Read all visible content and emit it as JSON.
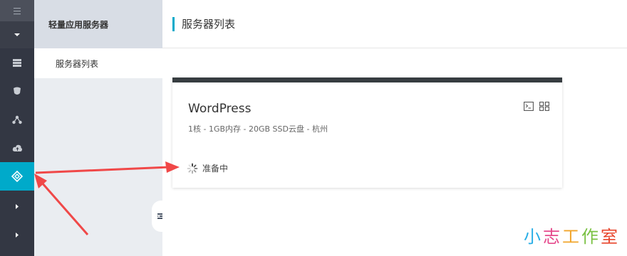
{
  "rail": {
    "active_item": "lightweight-server",
    "active_color": "#00aaca"
  },
  "subnav": {
    "heading": "轻量应用服务器",
    "items": [
      {
        "label": "服务器列表"
      }
    ]
  },
  "main": {
    "page_title": "服务器列表"
  },
  "server_card": {
    "name": "WordPress",
    "spec": "1核 - 1GB内存 - 20GB SSD云盘 - 杭州",
    "status": "准备中"
  },
  "watermark": {
    "chars": [
      {
        "text": "小",
        "color": "#29aee6"
      },
      {
        "text": "志",
        "color": "#e54a8c"
      },
      {
        "text": "工",
        "color": "#f1a52b"
      },
      {
        "text": "作",
        "color": "#7ac143"
      },
      {
        "text": "室",
        "color": "#e8452c"
      }
    ]
  },
  "annotation_color": "#f04848"
}
